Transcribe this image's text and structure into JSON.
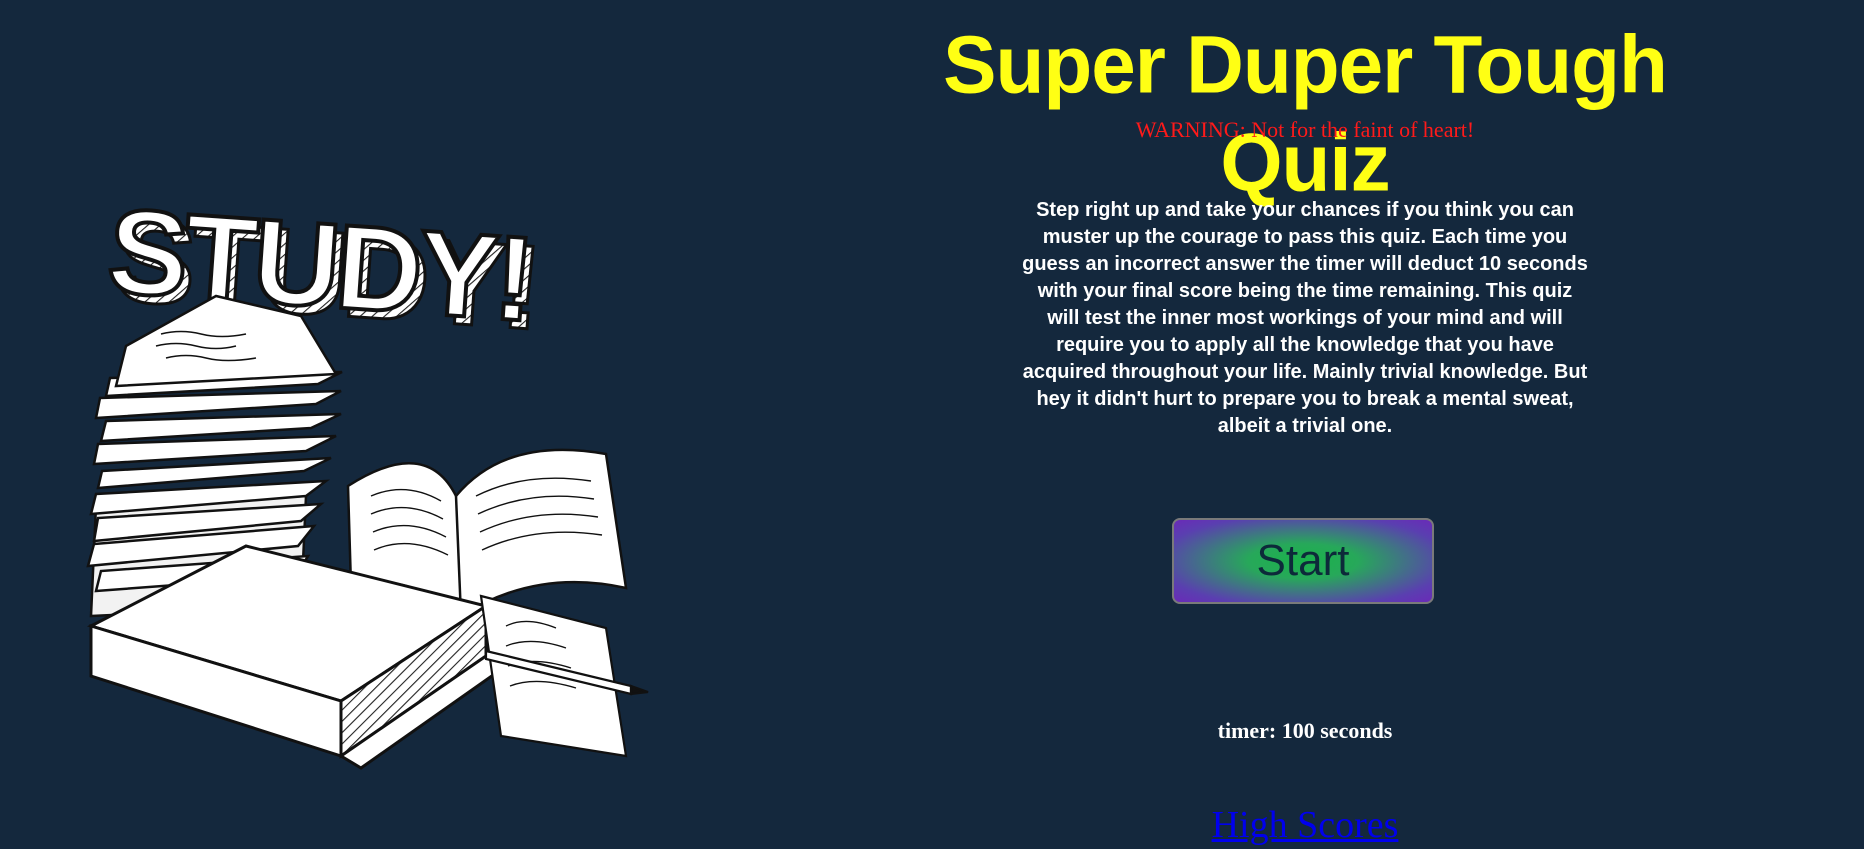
{
  "header": {
    "title": "Super Duper Tough Quiz",
    "warning": "WARNING: Not for the faint of heart!"
  },
  "intro": {
    "description": "Step right up and take your chances if you think you can muster up the courage to pass this quiz. Each time you guess an incorrect answer the timer will deduct 10 seconds with your final score being the time remaining. This quiz will test the inner most workings of your mind and will require you to apply all the knowledge that you have acquired throughout your life. Mainly trivial knowledge. But hey it didn't hurt to prepare you to break a mental sweat, albeit a trivial one."
  },
  "controls": {
    "start_label": "Start"
  },
  "timer": {
    "text": "timer: 100 seconds"
  },
  "links": {
    "high_scores": "High Scores"
  },
  "illustration": {
    "lettering": "STUDY!",
    "icon": "study-books-illustration"
  },
  "colors": {
    "background": "#14283d",
    "title": "#ffff14",
    "warning": "#ff1a1a",
    "link": "#0000ee"
  }
}
